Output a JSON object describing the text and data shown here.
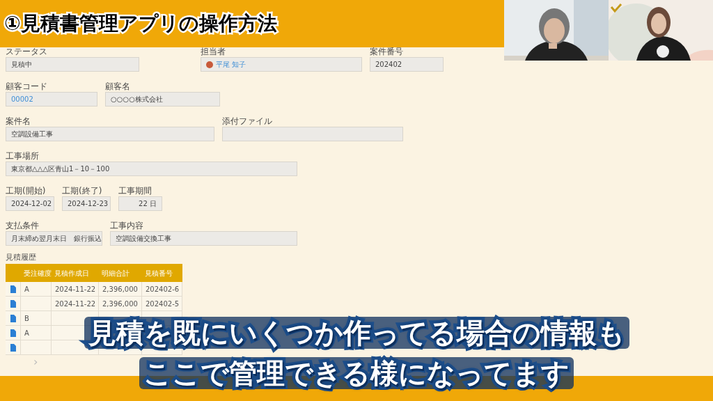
{
  "banner": {
    "title": "①見積書管理アプリの操作方法"
  },
  "webcams": [
    {
      "kind": "picture"
    },
    {
      "kind": "picture"
    }
  ],
  "form": {
    "rows": [
      [
        {
          "label": "ステータス",
          "value": "見積中"
        },
        {
          "label": "担当者",
          "value": "平尾 知子",
          "kind": "user"
        },
        {
          "label": "案件番号",
          "value": "202402"
        }
      ],
      [
        {
          "label": "顧客コード",
          "value": "00002",
          "kind": "link"
        },
        {
          "label": "顧客名",
          "value": "○○○○株式会社"
        }
      ],
      [
        {
          "label": "案件名",
          "value": "空調設備工事"
        },
        {
          "label": "添付ファイル",
          "kind": "file"
        }
      ],
      [
        {
          "label": "工事場所",
          "value": "東京都△△△区青山1－10－100"
        }
      ],
      [
        {
          "label": "工期(開始)",
          "value": "2024-12-02"
        },
        {
          "label": "工期(終了)",
          "value": "2024-12-23"
        },
        {
          "label": "工事期間",
          "value": "22 日",
          "kind": "number"
        }
      ],
      [
        {
          "label": "支払条件",
          "value": "月末締め翌月末日　銀行振込"
        },
        {
          "label": "工事内容",
          "value": "空調設備交換工事"
        }
      ]
    ]
  },
  "history": {
    "label": "見積履歴",
    "columns": [
      "受注確度",
      "見積作成日",
      "明細合計",
      "見積番号"
    ],
    "rows": [
      {
        "kind": "record",
        "cells": [
          "A",
          "2024-11-22",
          "2,396,000",
          "202402-6"
        ]
      },
      {
        "kind": "record",
        "cells": [
          "",
          "2024-11-22",
          "2,396,000",
          "202402-5"
        ]
      },
      {
        "kind": "record",
        "cells": [
          "B"
        ]
      },
      {
        "kind": "record",
        "cells": [
          "A"
        ]
      },
      {
        "kind": "record"
      }
    ],
    "pager": "›"
  },
  "subtitle": [
    "見積を既にいくつか作ってる場合の情報も",
    "ここで管理できる様になってます"
  ]
}
